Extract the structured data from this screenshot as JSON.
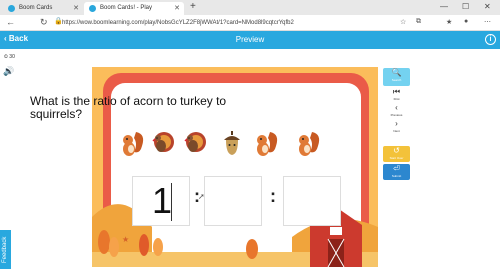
{
  "browser": {
    "tabs": [
      {
        "title": "Boom Cards"
      },
      {
        "title": "Boom Cards! - Play"
      }
    ],
    "url": "https://wow.boomlearning.com/play/NobsGcYLZ2F8jWWAt/1?card=NMod8l9cqtcrYqfb2"
  },
  "header": {
    "back_label": "Back",
    "title": "Preview",
    "info_label": "i"
  },
  "tools": {
    "timer_label": "30"
  },
  "card": {
    "question": "What is the ratio of acorn to turkey to squirrels?",
    "pictures": [
      "squirrel",
      "turkey",
      "turkey",
      "acorn",
      "squirrel",
      "squirrel"
    ],
    "answers": [
      "1",
      "",
      ""
    ],
    "separator": ":"
  },
  "side_controls": {
    "search": "Search",
    "first": "First",
    "previous": "Previous",
    "next": "Next",
    "start_over": "Start Over",
    "submit": "Submit"
  },
  "feedback_label": "Feedback"
}
